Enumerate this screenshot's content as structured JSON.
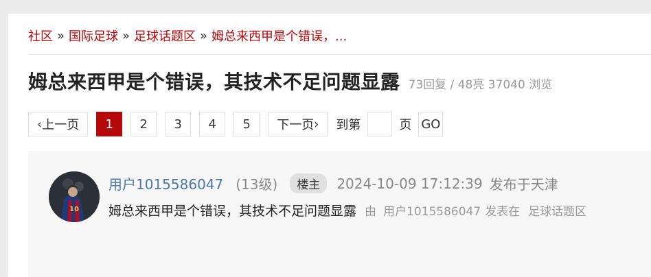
{
  "breadcrumb": {
    "items": [
      "社区",
      "国际足球",
      "足球话题区",
      "姆总来西甲是个错误，..."
    ],
    "separator": "»"
  },
  "thread": {
    "title": "姆总来西甲是个错误，其技术不足问题显露",
    "stats": "73回复 / 48亮 37040 浏览"
  },
  "pagination": {
    "prev_label": "上一页",
    "next_label": "下一页",
    "pages": [
      "1",
      "2",
      "3",
      "4",
      "5"
    ],
    "current_page": "1",
    "goto_label": "到第",
    "page_unit": "页",
    "go_label": "GO",
    "input_value": ""
  },
  "post": {
    "username": "用户1015586047",
    "level": "(13级)",
    "badge": "楼主",
    "time": "2024-10-09 17:12:39",
    "location": "发布于天津",
    "title": "姆总来西甲是个错误，其技术不足问题显露",
    "by_label": "由",
    "author": "用户1015586047",
    "posted_label": "发表在",
    "forum": "足球话题区"
  },
  "colors": {
    "accent": "#b5080a",
    "username": "#4a79a8"
  }
}
